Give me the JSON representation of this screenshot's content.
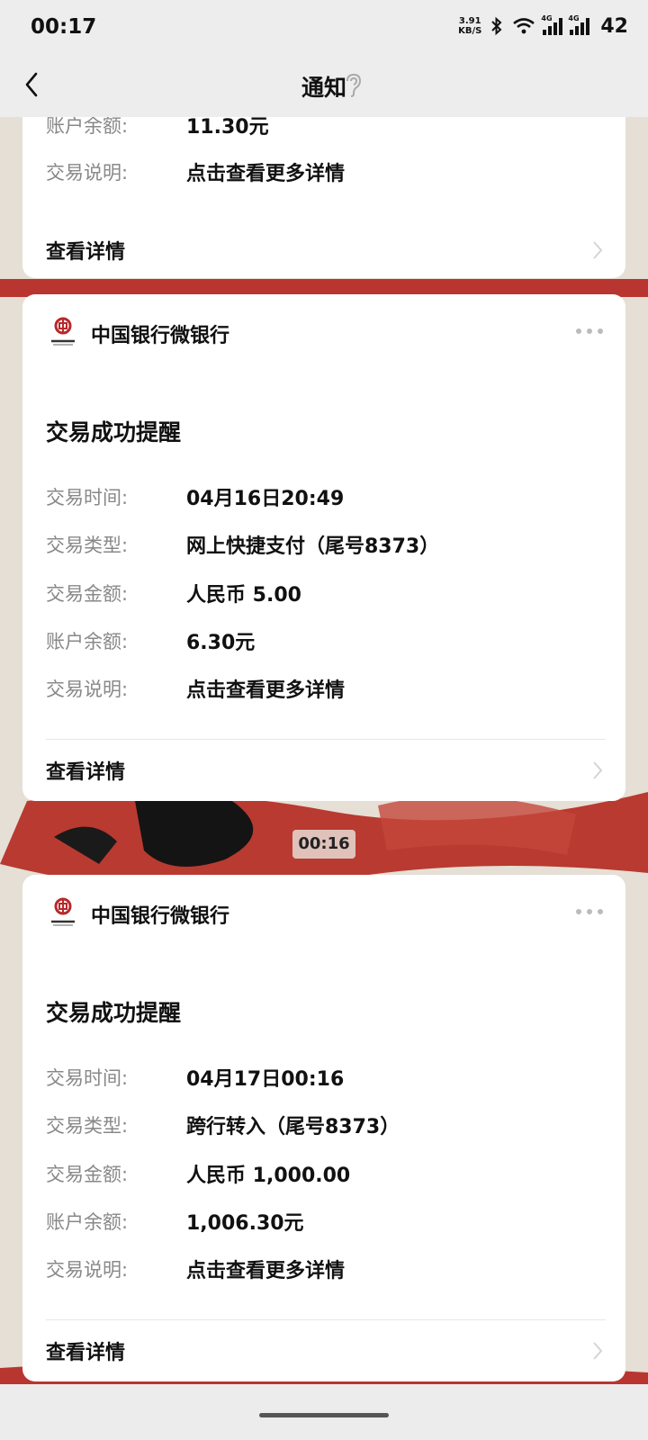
{
  "status_bar": {
    "time": "00:17",
    "net_speed_value": "3.91",
    "net_speed_unit": "KB/S",
    "signal_tag_1": "4G",
    "signal_tag_2": "4G",
    "battery": "42"
  },
  "nav": {
    "title": "通知"
  },
  "cards": [
    {
      "rows": [
        {
          "label": "账户余额:",
          "value": "11.30元"
        },
        {
          "label": "交易说明:",
          "value": "点击查看更多详情"
        }
      ],
      "detail_label": "查看详情"
    },
    {
      "bank_name": "中国银行微银行",
      "title": "交易成功提醒",
      "rows": [
        {
          "label": "交易时间:",
          "value": "04月16日20:49"
        },
        {
          "label": "交易类型:",
          "value": "网上快捷支付（尾号8373）"
        },
        {
          "label": "交易金额:",
          "value": "人民币 5.00"
        },
        {
          "label": "账户余额:",
          "value": "6.30元"
        },
        {
          "label": "交易说明:",
          "value": "点击查看更多详情"
        }
      ],
      "detail_label": "查看详情"
    },
    {
      "bank_name": "中国银行微银行",
      "title": "交易成功提醒",
      "rows": [
        {
          "label": "交易时间:",
          "value": "04月17日00:16"
        },
        {
          "label": "交易类型:",
          "value": "跨行转入（尾号8373）"
        },
        {
          "label": "交易金额:",
          "value": "人民币 1,000.00"
        },
        {
          "label": "账户余额:",
          "value": "1,006.30元"
        },
        {
          "label": "交易说明:",
          "value": "点击查看更多详情"
        }
      ],
      "detail_label": "查看详情"
    }
  ],
  "time_separator": "00:16",
  "icons": {
    "back": "chevron-left-icon",
    "ear": "ear-icon",
    "bank_logo": "boc-logo-icon",
    "more": "more-dots-icon",
    "detail_arrow": "chevron-right-icon"
  },
  "colors": {
    "brand_red": "#b8292b",
    "card_bg": "#ffffff",
    "label_gray": "#888888"
  }
}
